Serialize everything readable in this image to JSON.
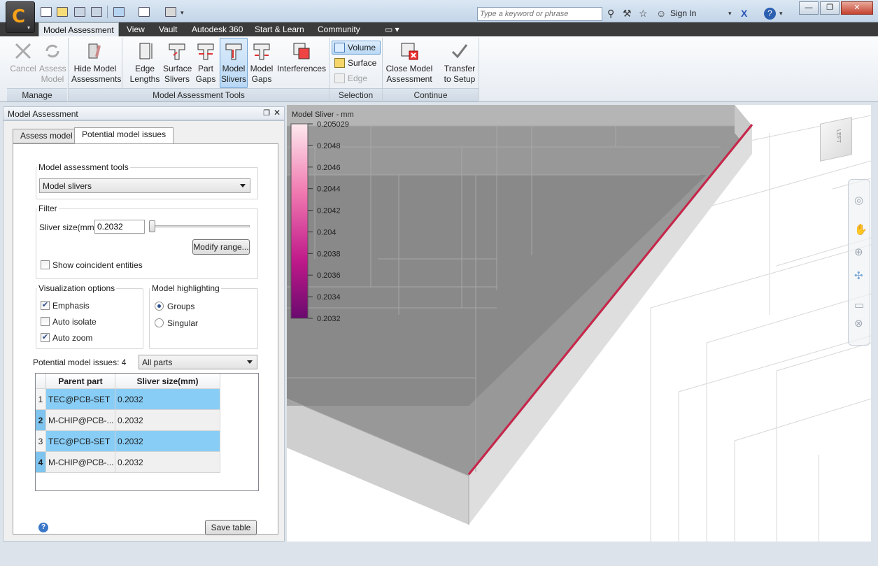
{
  "app": {
    "logo_letter": "C",
    "logo_menu_arrow": "▾"
  },
  "titlebar": {
    "search_placeholder": "Type a keyword or phrase",
    "sign_in": "Sign In",
    "minimize": "—",
    "restore": "❐",
    "close": "✕"
  },
  "menu": {
    "tabs": [
      "Model Assessment",
      "View",
      "Vault",
      "Autodesk 360",
      "Start & Learn",
      "Community"
    ],
    "active_index": 0
  },
  "ribbon": {
    "manage": {
      "label": "Manage",
      "cancel": "Cancel",
      "assess_model": "Assess Model"
    },
    "tools": {
      "label": "Model Assessment Tools",
      "hide_model_assessments": "Hide Model Assessments",
      "edge_lengths": "Edge Lengths",
      "surface_slivers": "Surface Slivers",
      "part_gaps": "Part Gaps",
      "model_slivers": "Model Slivers",
      "model_gaps": "Model Gaps",
      "interferences": "Interferences"
    },
    "selection": {
      "label": "Selection",
      "volume": "Volume",
      "surface": "Surface",
      "edge": "Edge"
    },
    "continue": {
      "label": "Continue",
      "close_model_assessment": "Close Model Assessment",
      "transfer_to_setup": "Transfer to Setup"
    }
  },
  "panel": {
    "title": "Model Assessment",
    "tabs": [
      "Assess model",
      "Potential model issues"
    ],
    "active_tab": 1,
    "tools_group": "Model assessment tools",
    "tool_selected": "Model slivers",
    "filter_group": "Filter",
    "sliver_size_label": "Sliver size(mm)",
    "sliver_size_value": "0.2032",
    "slider_position_fraction": 0.0,
    "modify_range": "Modify range...",
    "show_coincident": "Show coincident entities",
    "show_coincident_checked": false,
    "viz_group": "Visualization options",
    "emphasis": "Emphasis",
    "emphasis_checked": true,
    "auto_isolate": "Auto isolate",
    "auto_isolate_checked": false,
    "auto_zoom": "Auto zoom",
    "auto_zoom_checked": true,
    "highlight_group": "Model highlighting",
    "groups": "Groups",
    "singular": "Singular",
    "highlight_selected": "Groups",
    "issues_label": "Potential model issues: 4",
    "parts_filter": "All parts",
    "table": {
      "headers": [
        "Parent part",
        "Sliver size(mm)"
      ],
      "rows": [
        {
          "n": "1",
          "part": "TEC@PCB-SET",
          "size": "0.2032",
          "selected": true
        },
        {
          "n": "2",
          "part": "M-CHIP@PCB-...",
          "size": "0.2032",
          "selected": false
        },
        {
          "n": "3",
          "part": "TEC@PCB-SET",
          "size": "0.2032",
          "selected": true
        },
        {
          "n": "4",
          "part": "M-CHIP@PCB-...",
          "size": "0.2032",
          "selected": false
        }
      ]
    },
    "save_table": "Save table"
  },
  "viewport": {
    "legend_title": "Model Sliver - mm",
    "legend_ticks": [
      "0.205029",
      "0.2048",
      "0.2046",
      "0.2044",
      "0.2042",
      "0.204",
      "0.2038",
      "0.2036",
      "0.2034",
      "0.2032"
    ],
    "viewcube_face": "LEFT",
    "legend_colors": [
      "#fde9ee",
      "#f07ab0",
      "#c01a8a",
      "#6a0a6e"
    ],
    "sliver_color": "#c8254a"
  }
}
